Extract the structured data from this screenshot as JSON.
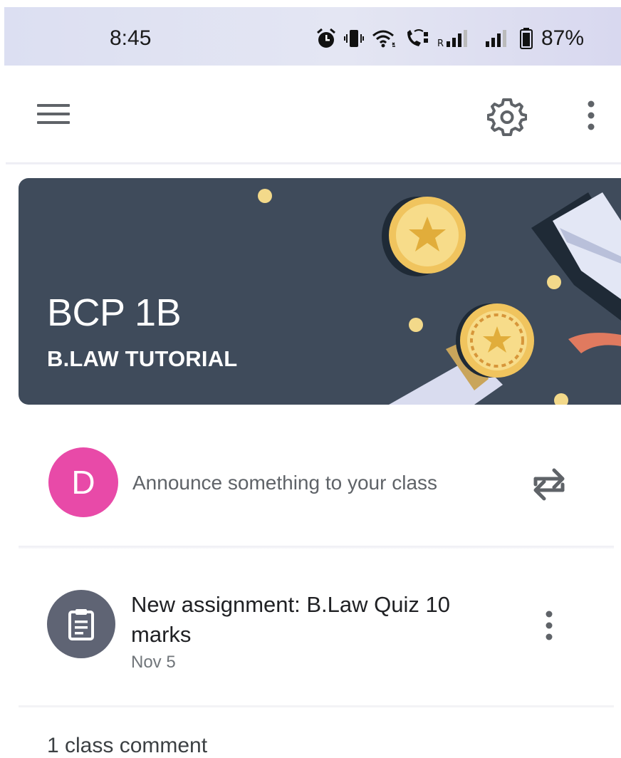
{
  "status_bar": {
    "time": "8:45",
    "battery": "87%",
    "icons": [
      "alarm-icon",
      "vibrate-icon",
      "wifi-icon",
      "wifi-calling-icon",
      "signal-r-icon",
      "signal-icon",
      "battery-icon"
    ]
  },
  "app_bar": {
    "menu_icon": "hamburger-menu-icon",
    "settings_icon": "gear-icon",
    "overflow_icon": "more-vert-icon"
  },
  "banner": {
    "class_name": "BCP 1B",
    "section": "B.LAW TUTORIAL",
    "background_color": "#3f4b5b"
  },
  "announce": {
    "avatar_letter": "D",
    "avatar_color": "#e84aa8",
    "placeholder": "Announce something to your class",
    "repost_icon": "repost-icon"
  },
  "post": {
    "icon": "assignment-icon",
    "title": "New assignment: B.Law Quiz 10 marks",
    "date": "Nov 5"
  },
  "comments": {
    "label": "1 class comment"
  }
}
